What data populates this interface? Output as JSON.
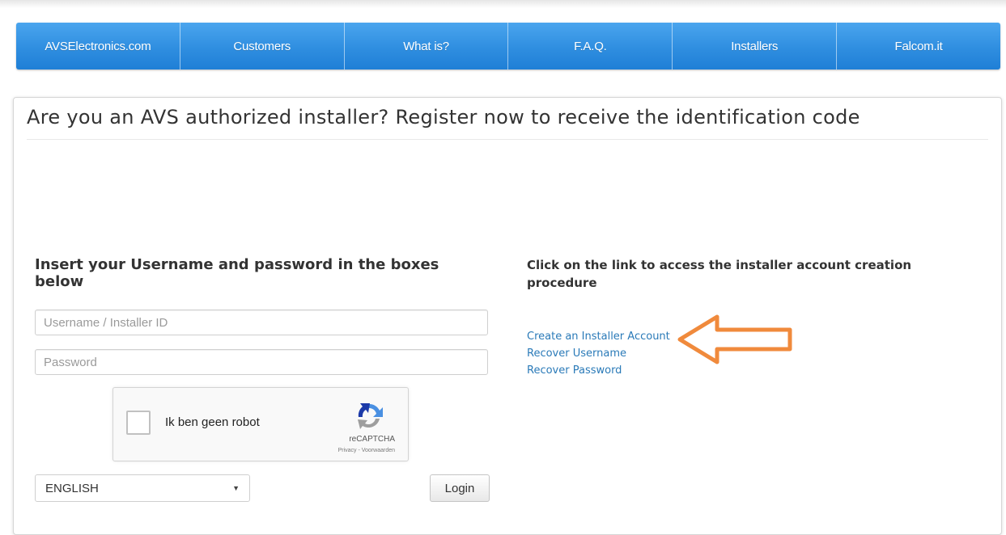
{
  "nav": {
    "items": [
      "AVSElectronics.com",
      "Customers",
      "What is?",
      "F.A.Q.",
      "Installers",
      "Falcom.it"
    ]
  },
  "page": {
    "title": "Are you an AVS authorized installer? Register now to receive the identification code"
  },
  "login": {
    "heading": "Insert your Username and password in the boxes below",
    "username_placeholder": "Username / Installer ID",
    "username_value": "",
    "password_placeholder": "Password",
    "password_value": "",
    "login_label": "Login"
  },
  "recaptcha": {
    "label": "Ik ben geen robot",
    "brand": "reCAPTCHA",
    "links": "Privacy - Voorwaarden",
    "checked": false
  },
  "language": {
    "selected": "ENGLISH"
  },
  "account": {
    "heading": "Click on the link to access the installer account creation procedure",
    "links": [
      "Create an Installer Account",
      "Recover Username",
      "Recover Password"
    ]
  },
  "colors": {
    "nav_blue": "#2f8ee0",
    "link_blue": "#2a7ab8",
    "arrow_orange": "#f08a3c"
  },
  "icons": {
    "recaptcha_logo": "recaptcha-logo-icon",
    "annotation_arrow": "arrow-left-icon",
    "select_caret": "caret-down-icon"
  }
}
